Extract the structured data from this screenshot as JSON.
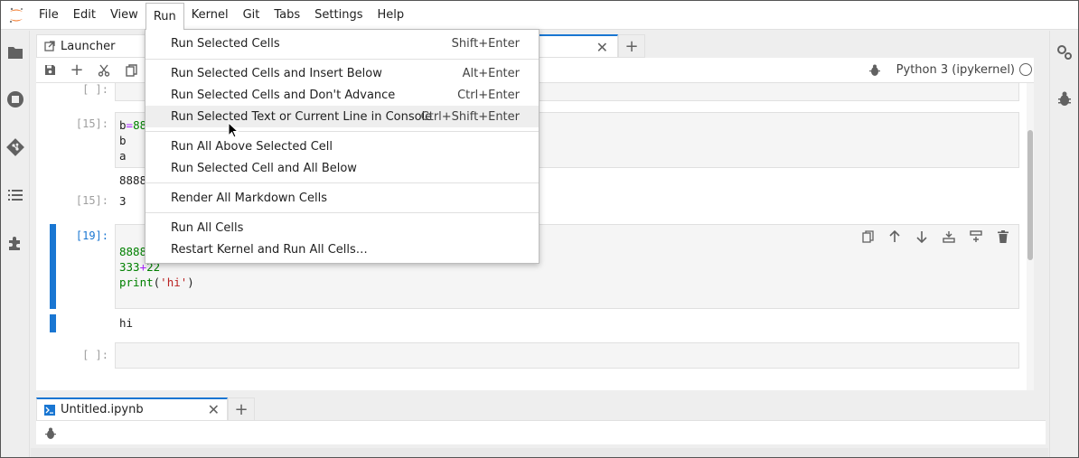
{
  "menubar": {
    "items": [
      "File",
      "Edit",
      "View",
      "Run",
      "Kernel",
      "Git",
      "Tabs",
      "Settings",
      "Help"
    ],
    "active": "Run"
  },
  "tabs": {
    "launcher_label": "Launcher",
    "add_label": "+"
  },
  "toolbar": {
    "kernel_name": "Python 3 (ipykernel)"
  },
  "cells": {
    "empty_prompt_top": "[ ]:",
    "cell15_prompt": "[15]:",
    "cell15_line1_a": "b",
    "cell15_line1_b": "=",
    "cell15_line1_c": "88",
    "cell15_line2": "b",
    "cell15_line3": "a",
    "cell15_stream": "8888",
    "out15_prompt": "[15]:",
    "out15_value": "3",
    "cell19_prompt": "[19]:",
    "cell19_line1": "8888",
    "cell19_line2_a": "333",
    "cell19_line2_b": "+",
    "cell19_line2_c": "22",
    "cell19_line3_a": "print",
    "cell19_line3_b": "(",
    "cell19_line3_c": "'hi'",
    "cell19_line3_d": ")",
    "out19_value": "hi",
    "empty_prompt_bottom": "[ ]:"
  },
  "bottom_panel": {
    "tab_label": "Untitled.ipynb",
    "add_label": "+"
  },
  "run_menu": {
    "items": [
      {
        "label": "Run Selected Cells",
        "shortcut": "Shift+Enter"
      },
      {
        "label": "Run Selected Cells and Insert Below",
        "shortcut": "Alt+Enter"
      },
      {
        "label": "Run Selected Cells and Don't Advance",
        "shortcut": "Ctrl+Enter"
      },
      {
        "label": "Run Selected Text or Current Line in Console",
        "shortcut": "Ctrl+Shift+Enter"
      },
      {
        "label": "Run All Above Selected Cell",
        "shortcut": ""
      },
      {
        "label": "Run Selected Cell and All Below",
        "shortcut": ""
      },
      {
        "label": "Render All Markdown Cells",
        "shortcut": ""
      },
      {
        "label": "Run All Cells",
        "shortcut": ""
      },
      {
        "label": "Restart Kernel and Run All Cells…",
        "shortcut": ""
      }
    ],
    "hovered_index": 3
  },
  "colors": {
    "accent": "#1976d2",
    "jupyter_orange": "#f37626",
    "icon_gray": "#616161"
  }
}
